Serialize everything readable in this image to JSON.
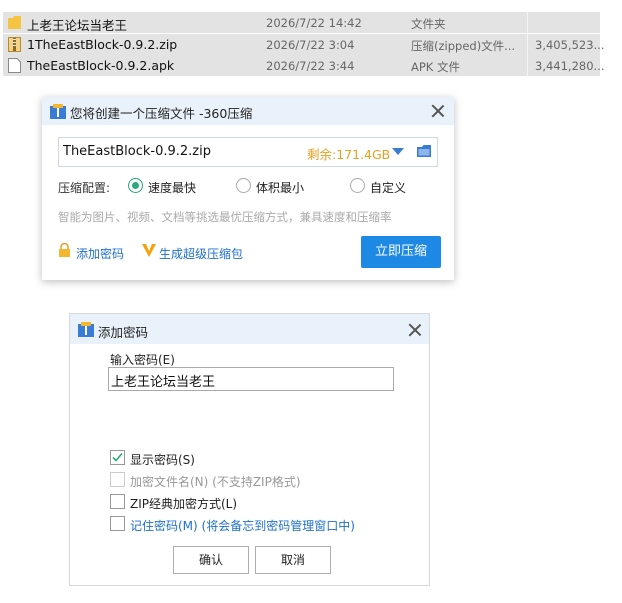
{
  "file_list": [
    {
      "name": "上老王论坛当老王",
      "date": "2026/7/22 14:42",
      "type": "文件夹",
      "size": "",
      "icon": "folder-icon"
    },
    {
      "name": "1TheEastBlock-0.9.2.zip",
      "date": "2026/7/22 3:04",
      "type": "压缩(zipped)文件...",
      "size": "3,405,523...",
      "icon": "zip-file-icon"
    },
    {
      "name": "TheEastBlock-0.9.2.apk",
      "date": "2026/7/22 3:44",
      "type": "APK 文件",
      "size": "3,441,280...",
      "icon": "file-icon"
    }
  ],
  "compress_dialog": {
    "title": "您将创建一个压缩文件 -360压缩",
    "filename": "TheEastBlock-0.9.2.zip",
    "free_space": "剩余:171.4GB",
    "config_label": "压缩配置:",
    "options": [
      "速度最快",
      "体积最小",
      "自定义"
    ],
    "selected_option": "速度最快",
    "hint": "智能为图片、视频、文档等挑选最优压缩方式，兼具速度和压缩率",
    "add_password": "添加密码",
    "super_pack": "生成超级压缩包",
    "compress_button": "立即压缩",
    "accent_color": "#1e88e5",
    "orange_color": "#e8a020"
  },
  "password_dialog": {
    "title": "添加密码",
    "input_label": "输入密码(E)",
    "password_value": "上老王论坛当老王",
    "show_password": "显示密码(S)",
    "show_password_checked": true,
    "encrypt_filenames": "加密文件名(N) (不支持ZIP格式)",
    "zip_classic": "ZIP经典加密方式(L)",
    "remember_password": "记住密码(M) (将会备忘到密码管理窗口中)",
    "ok_button": "确认",
    "cancel_button": "取消"
  }
}
